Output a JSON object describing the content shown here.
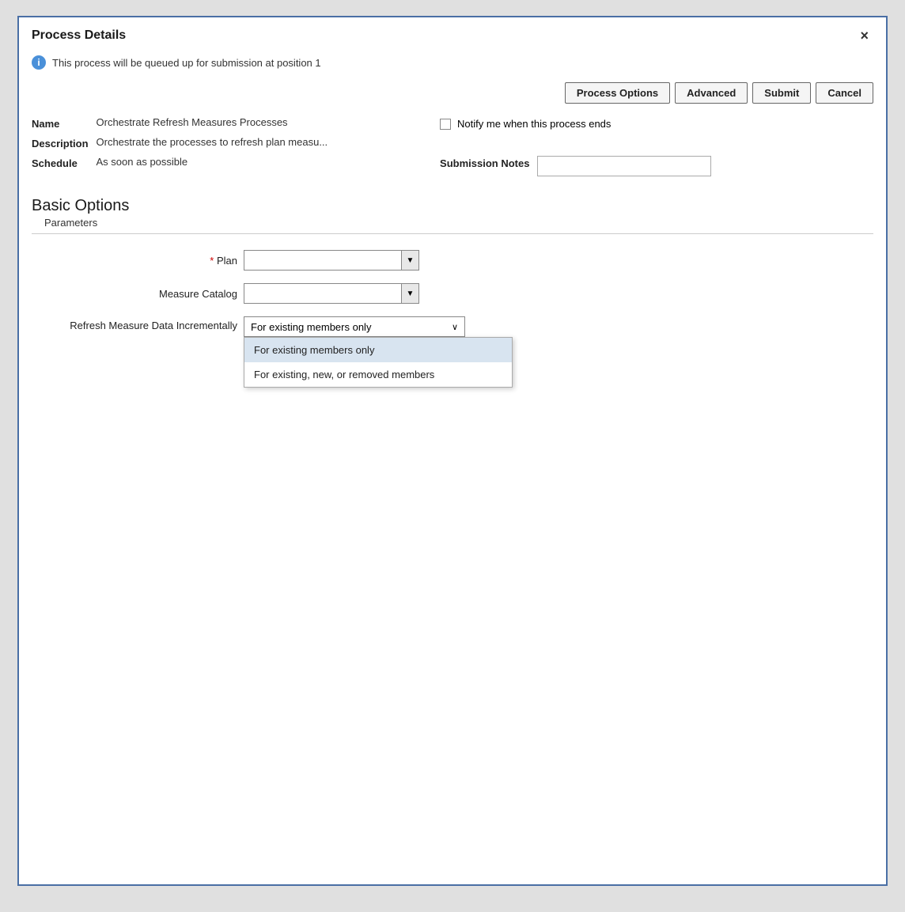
{
  "dialog": {
    "title": "Process Details",
    "close_label": "×"
  },
  "info": {
    "message": "This process will be queued up for submission at position 1",
    "icon": "i"
  },
  "toolbar": {
    "process_options_label": "Process Options",
    "advanced_label": "Advanced",
    "submit_label": "Submit",
    "cancel_label": "Cancel"
  },
  "details": {
    "name_label": "Name",
    "name_value": "Orchestrate Refresh Measures Processes",
    "description_label": "Description",
    "description_value": "Orchestrate the processes to refresh plan measu...",
    "notify_label": "Notify me when this process ends",
    "schedule_label": "Schedule",
    "schedule_value": "As soon as possible",
    "submission_notes_label": "Submission Notes",
    "submission_notes_value": ""
  },
  "basic_options": {
    "title": "Basic Options",
    "subtitle": "Parameters",
    "plan_label": "* Plan",
    "plan_required_star": "*",
    "plan_label_text": "Plan",
    "measure_catalog_label": "Measure Catalog",
    "refresh_label": "Refresh Measure Data Incrementally",
    "refresh_selected": "For existing members only",
    "refresh_options": [
      {
        "value": "existing_only",
        "label": "For existing members only"
      },
      {
        "value": "all_members",
        "label": "For existing, new, or removed members"
      }
    ]
  }
}
